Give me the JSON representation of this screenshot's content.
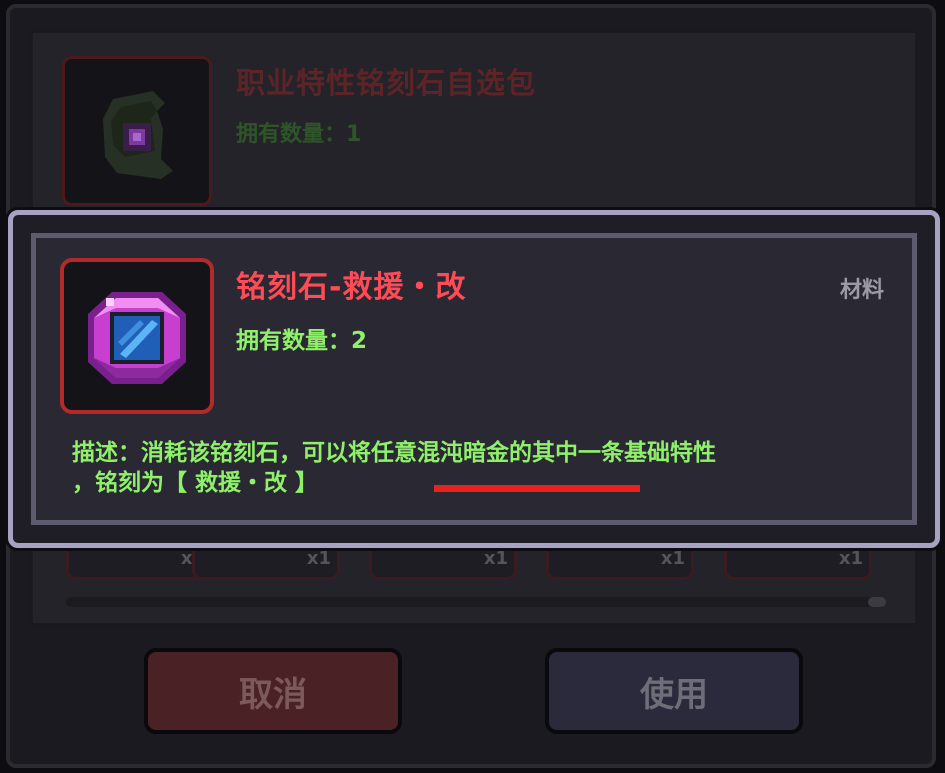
{
  "background_item": {
    "name": "职业特性铭刻石自选包",
    "count_label": "拥有数量：1"
  },
  "slots": [
    {
      "qty": "x1"
    },
    {
      "qty": "x1"
    },
    {
      "qty": "x1"
    },
    {
      "qty": "x1"
    },
    {
      "qty": "x1"
    }
  ],
  "tooltip": {
    "name": "铭刻石-救援・改",
    "count_label": "拥有数量：2",
    "category": "材料",
    "description_line1": "描述：消耗该铭刻石，可以将任意混沌暗金的其中一条基础特性",
    "description_line2": "，铭刻为【 救援・改 】"
  },
  "buttons": {
    "cancel_label": "取消",
    "use_label": "使用"
  },
  "colors": {
    "item_name_red": "#ff4b55",
    "text_green": "#8ff06a",
    "annotation_red": "#e8221e",
    "tooltip_border": "#a7a2c2"
  }
}
